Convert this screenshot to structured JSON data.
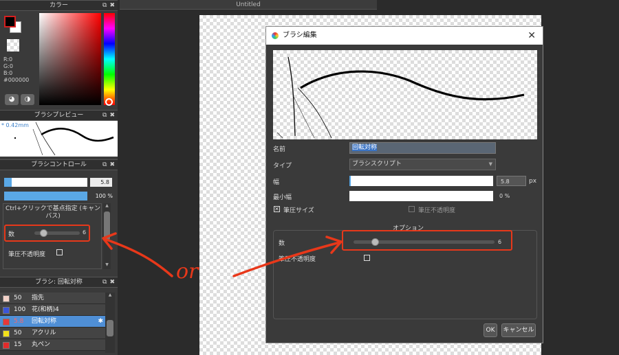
{
  "document": {
    "tab_title": "Untitled"
  },
  "color_panel": {
    "title": "カラー",
    "r": "R:0",
    "g": "G:0",
    "b": "B:0",
    "hex": "#000000",
    "foreground_color": "#000000",
    "accent": "#d61f1f"
  },
  "brush_preview_panel": {
    "title": "ブラシプレビュー",
    "size_text": "* 0.42mm"
  },
  "brush_control_panel": {
    "title": "ブラシコントロール",
    "width_value": "5.8",
    "opacity_value": "100 %",
    "hint_text": "Ctrl+クリックで基点指定 (キャンバス)",
    "count_label": "数",
    "count_value": "6",
    "pressure_opacity_label": "筆圧不透明度"
  },
  "brush_list_panel": {
    "title": "ブラシ: 回転対称",
    "items": [
      {
        "num": "50",
        "name": "指先",
        "swatch": "#f3d2c8",
        "selected": false
      },
      {
        "num": "100",
        "name": "花(和柄)4",
        "swatch": "#3b55d9",
        "selected": false
      },
      {
        "num": "5.8",
        "name": "回転対称",
        "swatch": "#e8383a",
        "selected": true
      },
      {
        "num": "50",
        "name": "アクリル",
        "swatch": "#f2e01a",
        "selected": false
      },
      {
        "num": "15",
        "name": "丸ペン",
        "swatch": "#e22b2b",
        "selected": false
      }
    ]
  },
  "dialog": {
    "title": "ブラシ編集",
    "name_label": "名前",
    "name_value": "回転対称",
    "type_label": "タイプ",
    "type_value": "ブラシスクリプト",
    "width_label": "幅",
    "width_value": "5.8",
    "width_unit": "px",
    "min_width_label": "最小幅",
    "min_width_value": "0 %",
    "pressure_size_label": "筆圧サイズ",
    "pressure_opacity_label": "筆圧不透明度",
    "options_label": "オプション",
    "count_label": "数",
    "count_value": "6",
    "pressure_opacity_label2": "筆圧不透明度",
    "ok_label": "OK",
    "cancel_label": "キャンセル"
  },
  "annotation": {
    "text": "or",
    "color": "#e8381a"
  }
}
